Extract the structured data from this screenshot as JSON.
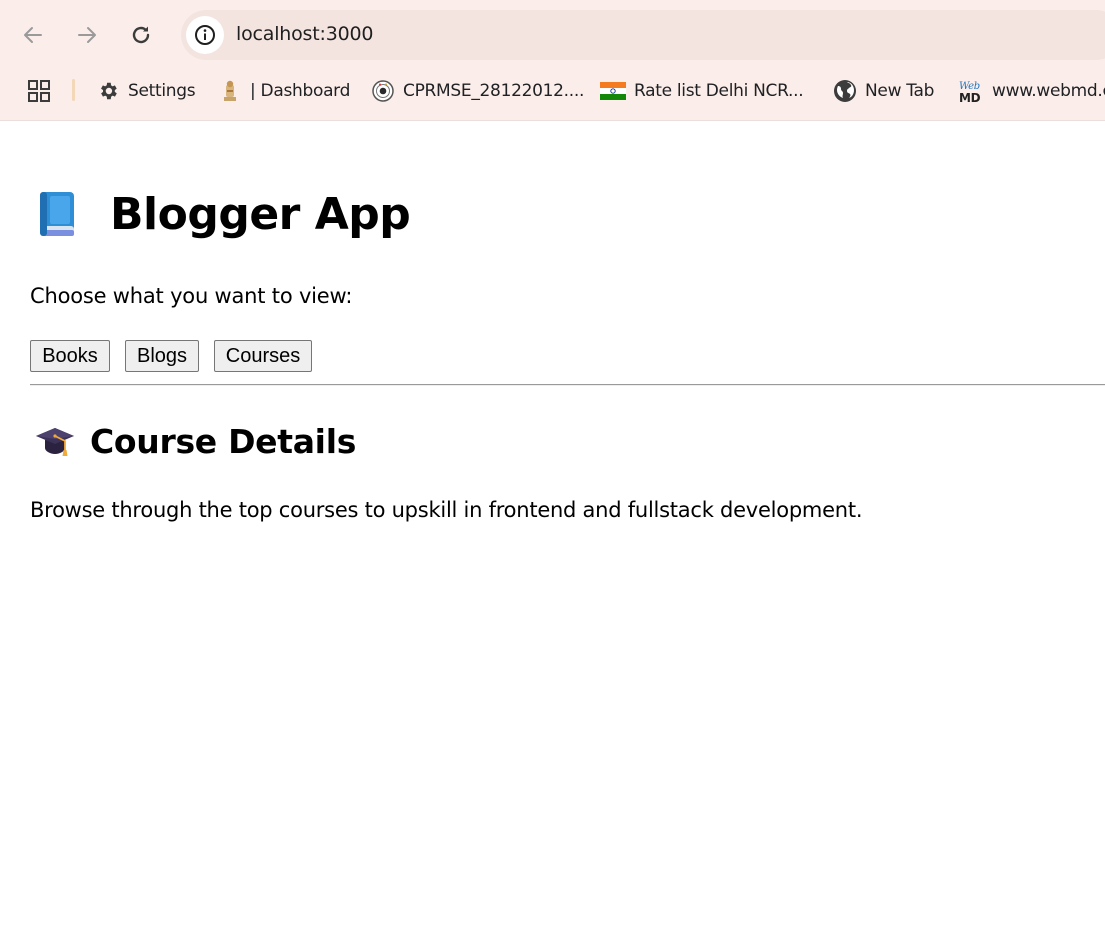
{
  "browser": {
    "url": "localhost:3000",
    "bookmarks": [
      {
        "label": "Settings",
        "icon": "gear-icon"
      },
      {
        "label": "| Dashboard",
        "icon": "emblem-icon"
      },
      {
        "label": "CPRMSE_28122012....",
        "icon": "seal-icon"
      },
      {
        "label": "Rate list Delhi NCR...",
        "icon": "india-flag-icon"
      },
      {
        "label": "New Tab",
        "icon": "globe-icon"
      },
      {
        "label": "www.webmd.c",
        "icon": "webmd-logo-icon"
      }
    ],
    "webmd_logo_text": "WebMD"
  },
  "app": {
    "title": "Blogger App",
    "title_icon": "blue-book-icon",
    "prompt": "Choose what you want to view:",
    "buttons": {
      "books": "Books",
      "blogs": "Blogs",
      "courses": "Courses"
    },
    "section": {
      "title": "Course Details",
      "icon": "graduation-cap-icon",
      "description": "Browse through the top courses to upskill in frontend and fullstack development."
    }
  }
}
